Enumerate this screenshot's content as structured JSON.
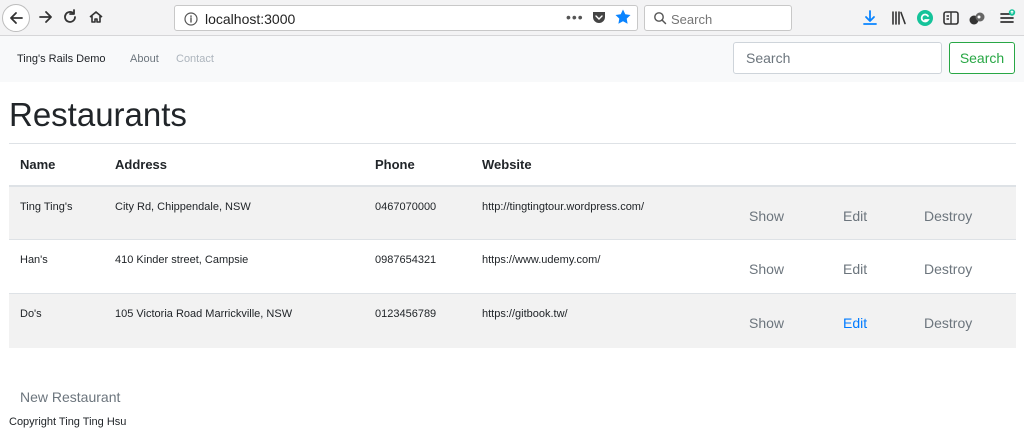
{
  "browser": {
    "url": "localhost:3000",
    "search_placeholder": "Search"
  },
  "navbar": {
    "brand": "Ting's Rails Demo",
    "about": "About",
    "contact": "Contact",
    "search_placeholder": "Search",
    "search_button": "Search"
  },
  "page": {
    "title": "Restaurants",
    "columns": [
      "Name",
      "Address",
      "Phone",
      "Website"
    ],
    "rows": [
      {
        "name": "Ting Ting's",
        "address": "City Rd, Chippendale, NSW",
        "phone": "0467070000",
        "website": "http://tingtingtour.wordpress.com/",
        "show": "Show",
        "edit": "Edit",
        "destroy": "Destroy"
      },
      {
        "name": "Han's",
        "address": "410 Kinder street, Campsie",
        "phone": "0987654321",
        "website": "https://www.udemy.com/",
        "show": "Show",
        "edit": "Edit",
        "destroy": "Destroy"
      },
      {
        "name": "Do's",
        "address": "105 Victoria Road Marrickville, NSW",
        "phone": "0123456789",
        "website": "https://gitbook.tw/",
        "show": "Show",
        "edit": "Edit",
        "destroy": "Destroy"
      }
    ],
    "new_link": "New Restaurant",
    "footer": "Copyright Ting Ting Hsu"
  },
  "colors": {
    "accent_blue": "#007bff",
    "success_green": "#28a745",
    "star_blue": "#0a84ff",
    "grammarly_green": "#15c39a"
  }
}
